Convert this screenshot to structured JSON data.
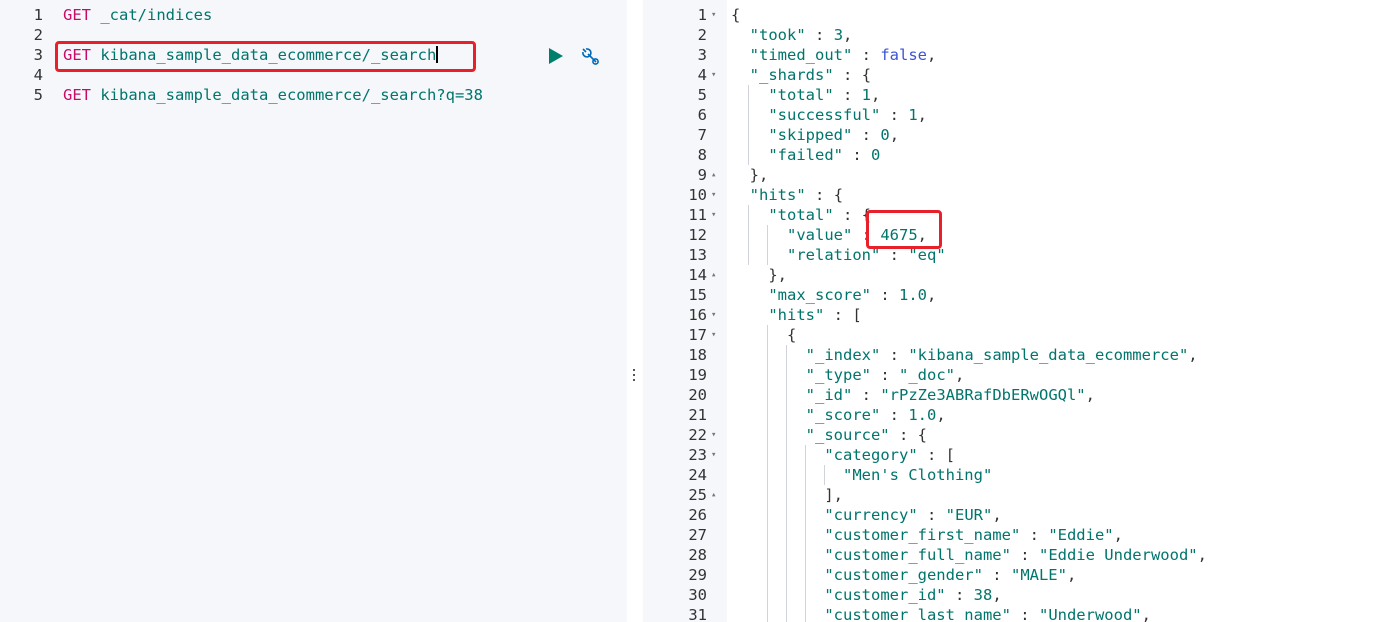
{
  "request_panel": {
    "line_numbers": [
      "1",
      "2",
      "3",
      "4",
      "5"
    ],
    "lines": [
      {
        "method": "GET",
        "path": "_cat/indices"
      },
      {
        "method": "",
        "path": ""
      },
      {
        "method": "GET",
        "path": "kibana_sample_data_ecommerce/_search"
      },
      {
        "method": "",
        "path": ""
      },
      {
        "method": "GET",
        "path": "kibana_sample_data_ecommerce/_search?q=38"
      }
    ],
    "run_icon": "play-icon",
    "settings_icon": "wrench-icon"
  },
  "response_panel": {
    "line_numbers": [
      "1",
      "2",
      "3",
      "4",
      "5",
      "6",
      "7",
      "8",
      "9",
      "10",
      "11",
      "12",
      "13",
      "14",
      "15",
      "16",
      "17",
      "18",
      "19",
      "20",
      "21",
      "22",
      "23",
      "24",
      "25",
      "26",
      "27",
      "28",
      "29",
      "30",
      "31"
    ],
    "lines": [
      "{",
      "  \"took\" : 3,",
      "  \"timed_out\" : false,",
      "  \"_shards\" : {",
      "    \"total\" : 1,",
      "    \"successful\" : 1,",
      "    \"skipped\" : 0,",
      "    \"failed\" : 0",
      "  },",
      "  \"hits\" : {",
      "    \"total\" : {",
      "      \"value\" : 4675,",
      "      \"relation\" : \"eq\"",
      "    },",
      "    \"max_score\" : 1.0,",
      "    \"hits\" : [",
      "      {",
      "        \"_index\" : \"kibana_sample_data_ecommerce\",",
      "        \"_type\" : \"_doc\",",
      "        \"_id\" : \"rPzZe3ABRafDbERwOGQl\",",
      "        \"_score\" : 1.0,",
      "        \"_source\" : {",
      "          \"category\" : [",
      "            \"Men's Clothing\"",
      "          ],",
      "          \"currency\" : \"EUR\",",
      "          \"customer_first_name\" : \"Eddie\",",
      "          \"customer_full_name\" : \"Eddie Underwood\",",
      "          \"customer_gender\" : \"MALE\",",
      "          \"customer_id\" : 38,",
      "          \"customer_last_name\" : \"Underwood\","
    ],
    "fold_open_lines": [
      1,
      4,
      10,
      11,
      16,
      17,
      22,
      23
    ],
    "fold_close_lines": [
      9,
      14,
      25
    ]
  },
  "colors": {
    "method": "#c80a68",
    "value": "#00756c",
    "keyword": "#3a54d7",
    "highlight_box": "#e8202a",
    "run_button": "#00806c"
  }
}
